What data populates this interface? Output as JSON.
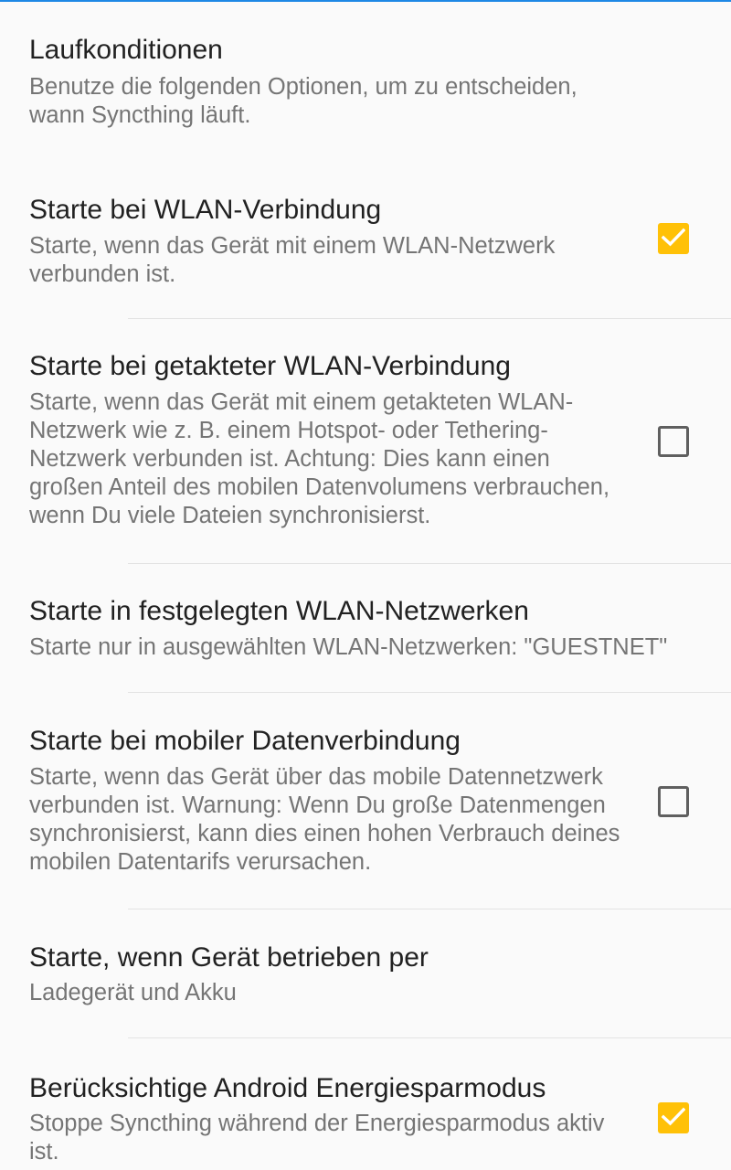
{
  "accent_color": "#ffc107",
  "header": {
    "title": "Laufkonditionen",
    "summary": "Benutze die folgenden Optionen, um zu entscheiden, wann Syncthing läuft."
  },
  "preferences": [
    {
      "title": "Starte bei WLAN-Verbindung",
      "summary": "Starte, wenn das Gerät mit einem WLAN-Netzwerk verbunden ist.",
      "checked": true,
      "icon": "check-icon"
    },
    {
      "title": "Starte bei getakteter WLAN-Verbindung",
      "summary": "Starte, wenn das Gerät mit einem getakteten WLAN-Netzwerk wie z. B. einem Hotspot- oder Tethering-Netzwerk verbunden ist. Achtung: Dies kann einen großen Anteil des mobilen Datenvolumens verbrauchen, wenn Du viele Dateien synchronisierst.",
      "checked": false
    },
    {
      "title": "Starte in festgelegten WLAN-Netzwerken",
      "summary": "Starte nur in ausgewählten WLAN-Netzwerken: \"GUESTNET\""
    },
    {
      "title": "Starte bei mobiler Datenverbindung",
      "summary": "Starte, wenn das Gerät über das mobile Datennetzwerk verbunden ist. Warnung: Wenn Du große Datenmengen synchronisierst, kann dies einen hohen Verbrauch deines mobilen Datentarifs verursachen.",
      "checked": false
    },
    {
      "title": "Starte, wenn Gerät betrieben per",
      "summary": "Ladegerät und Akku"
    },
    {
      "title": "Berücksichtige Android Energiesparmodus",
      "summary": "Stoppe Syncthing während der Energiesparmodus aktiv ist.",
      "checked": true,
      "icon": "check-icon"
    }
  ]
}
